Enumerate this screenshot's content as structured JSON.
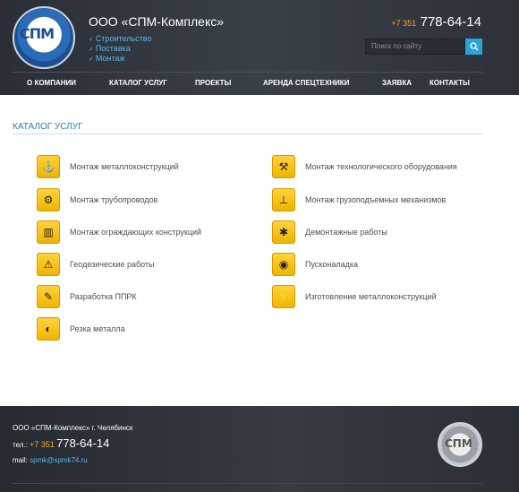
{
  "header": {
    "logo_text": "СПМ",
    "company_name": "ООО «СПМ-Комплекс»",
    "taglines": [
      "Строительство",
      "Поставка",
      "Монтаж"
    ],
    "phone_code": "+7 351",
    "phone_number": "778-64-14",
    "search_placeholder": "Поиск по сайту"
  },
  "nav": [
    "О КОМПАНИИ",
    "КАТАЛОГ УСЛУГ",
    "ПРОЕКТЫ",
    "АРЕНДА СПЕЦТЕХНИКИ",
    "ЗАЯВКА",
    "КОНТАКТЫ"
  ],
  "catalog": {
    "title": "КАТАЛОГ УСЛУГ",
    "left": [
      {
        "label": "Монтаж металлоконструкций",
        "icon": "crane-hook-icon"
      },
      {
        "label": "Монтаж трубопроводов",
        "icon": "valve-icon"
      },
      {
        "label": "Монтаж ограждающих конструкций",
        "icon": "fence-icon"
      },
      {
        "label": "Геодезические работы",
        "icon": "theodolite-icon"
      },
      {
        "label": "Разработка ППРК",
        "icon": "drawing-tools-icon"
      },
      {
        "label": "Резка металла",
        "icon": "cutting-disc-icon"
      }
    ],
    "right": [
      {
        "label": "Монтаж технологического оборудования",
        "icon": "equipment-hoist-icon"
      },
      {
        "label": "Монтаж грузоподъемных механизмов",
        "icon": "hoist-icon"
      },
      {
        "label": "Демонтажные работы",
        "icon": "demolition-icon"
      },
      {
        "label": "Пусконаладка",
        "icon": "gauge-icon"
      },
      {
        "label": "Изготовление металлоконструкций",
        "icon": "welding-icon"
      }
    ]
  },
  "footer": {
    "address": "ООО «СПМ-Комплекс» г. Челябинск",
    "tel_label": "тел.:",
    "phone_code": "+7 351",
    "phone_number": "778-64-14",
    "mail_label": "mail:",
    "email": "spmk@spmk74.ru",
    "logo_text": "СПМ"
  }
}
